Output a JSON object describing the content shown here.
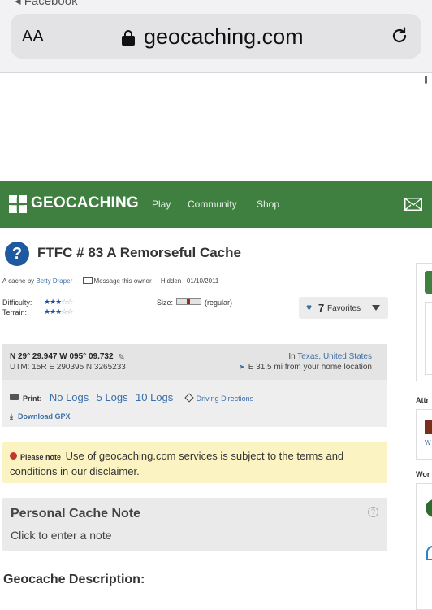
{
  "browser": {
    "back_label": "◂ Facebook",
    "text_size": "AA",
    "domain": "geocaching.com"
  },
  "header": {
    "logo": "GEOCACHING",
    "nav": [
      "Play",
      "Community",
      "Shop"
    ]
  },
  "cache": {
    "title": "FTFC # 83 A Remorseful Cache",
    "by_prefix": "A cache by",
    "owner": "Betty Draper",
    "message_owner": "Message this owner",
    "hidden": "Hidden : 01/10/2011",
    "difficulty_label": "Difficulty:",
    "terrain_label": "Terrain:",
    "difficulty_stars": {
      "on": "★★",
      "half": "★",
      "off": "☆☆"
    },
    "terrain_stars": {
      "on": "★★★",
      "off": "☆☆"
    },
    "size_label": "Size:",
    "size_text": "(regular)",
    "favorites_count": "7",
    "favorites_label": "Favorites"
  },
  "location": {
    "coords": "N 29° 29.947 W 095° 09.732",
    "utm": "UTM: 15R E 290395 N 3265233",
    "in_prefix": "In",
    "state": "Texas",
    "country": "United States",
    "distance": "E 31.5 mi from your home location"
  },
  "print": {
    "label": "Print:",
    "options": [
      "No Logs",
      "5 Logs",
      "10 Logs"
    ],
    "driving": "Driving Directions",
    "gpx": "Download GPX"
  },
  "notice": {
    "prefix": "Please note",
    "text": "Use of geocaching.com services is subject to the terms and conditions in our disclaimer."
  },
  "personal_note": {
    "title": "Personal Cache Note",
    "prompt": "Click to enter a note",
    "help": "?"
  },
  "description_title": "Geocache Description:",
  "sidebar": {
    "attr_label": "Attr",
    "attr_link": "W",
    "wor_label": "Wor"
  }
}
